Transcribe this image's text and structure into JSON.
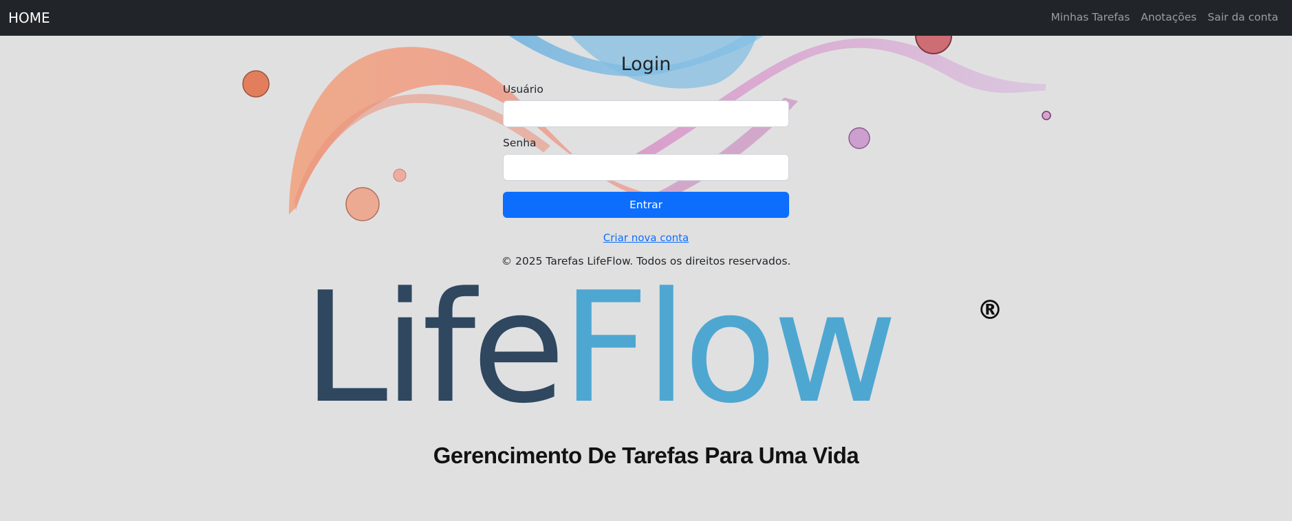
{
  "navbar": {
    "brand": "HOME",
    "links": [
      "Minhas Tarefas",
      "Anotações",
      "Sair da conta"
    ]
  },
  "login": {
    "title": "Login",
    "username_label": "Usuário",
    "username_value": "",
    "password_label": "Senha",
    "password_value": "",
    "submit_label": "Entrar",
    "signup_link": "Criar nova conta"
  },
  "footer": {
    "copyright": "© 2025 Tarefas LifeFlow. Todos os direitos reservados."
  },
  "logo": {
    "part1": "Life",
    "part2": "Flow",
    "registered": "®",
    "tagline": "Gerencimento De Tarefas Para Uma Vida"
  },
  "colors": {
    "navbar": "#212529",
    "primary": "#0d6efd",
    "logo_dark": "#2f475f",
    "logo_light": "#4ea7d1",
    "background": "#e0e0e1"
  }
}
